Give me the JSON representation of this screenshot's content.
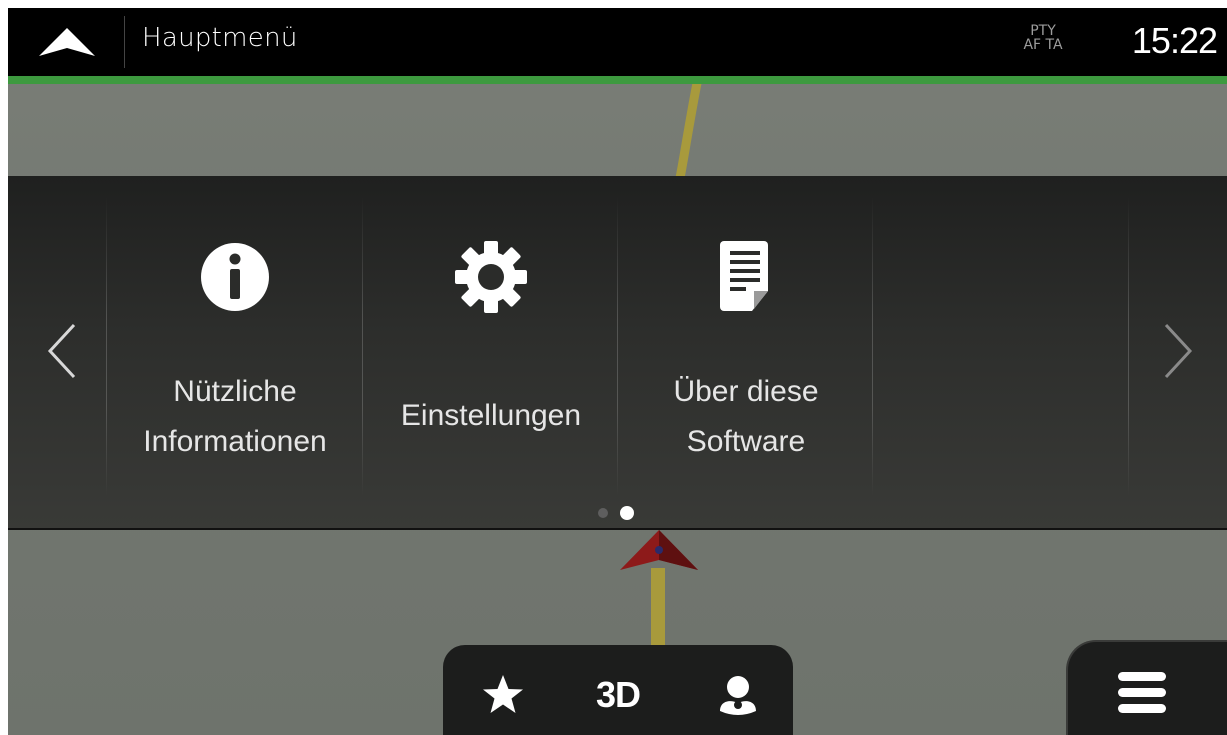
{
  "header": {
    "title": "Hauptmenü",
    "rds_line1": "PTY",
    "rds_line2": "AF TA",
    "time": "15:22",
    "accent_color": "#3d9a3f"
  },
  "menu": {
    "items": [
      {
        "icon": "info-icon",
        "line1": "Nützliche",
        "line2": "Informationen"
      },
      {
        "icon": "gear-icon",
        "line1": "Einstellungen",
        "line2": ""
      },
      {
        "icon": "document-icon",
        "line1": "Über diese",
        "line2": "Software"
      }
    ],
    "page_count": 2,
    "current_page": 2
  },
  "toolbar": {
    "favorites_icon": "star-icon",
    "view_mode_label": "3D",
    "contacts_icon": "person-pin-icon"
  },
  "main_menu_icon": "hamburger-icon"
}
